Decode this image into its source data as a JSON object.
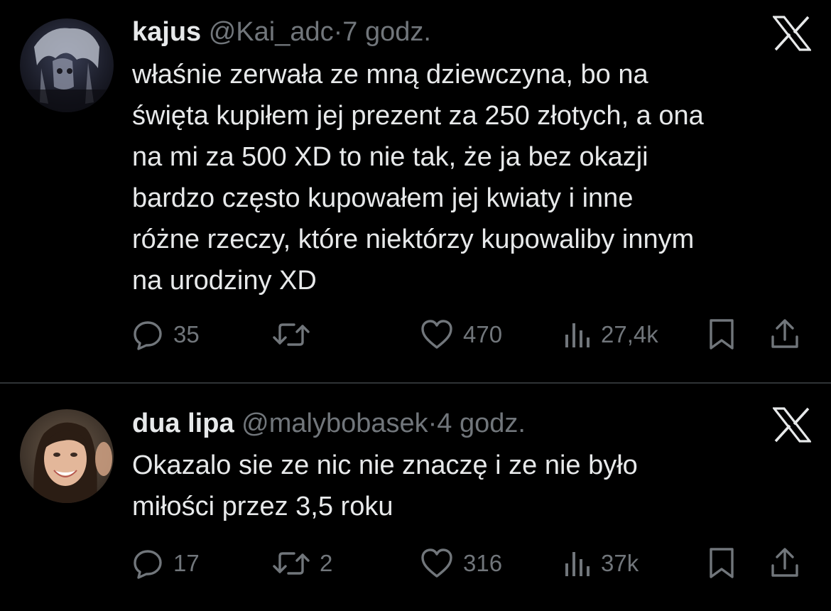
{
  "tweets": [
    {
      "display_name": "kajus",
      "handle": "@Kai_adc",
      "separator": "·",
      "time": "7 godz.",
      "text": "właśnie zerwała ze mną dziewczyna, bo na\nświęta kupiłem jej prezent za 250 złotych, a ona\nna mi za 500 XD to nie tak, że ja bez okazji\nbardzo często kupowałem jej kwiaty i inne\nróżne rzeczy, które niektórzy kupowaliby innym\nna urodziny XD",
      "replies": "35",
      "reposts": "",
      "likes": "470",
      "views": "27,4k",
      "avatar_icon": "dark-anime-avatar"
    },
    {
      "display_name": "dua lipa",
      "handle": "@malybobasek",
      "separator": "·",
      "time": "4 godz.",
      "text": "Okazalo sie ze nic nie znaczę i ze nie było\nmiłości przez 3,5 roku",
      "replies": "17",
      "reposts": "2",
      "likes": "316",
      "views": "37k",
      "avatar_icon": "smiling-woman-avatar"
    }
  ],
  "icons": {
    "brand": "x-logo-icon",
    "reply": "reply-icon",
    "repost": "repost-icon",
    "like": "heart-icon",
    "views": "views-icon",
    "bookmark": "bookmark-icon",
    "share": "share-icon"
  },
  "colors": {
    "background": "#000000",
    "text": "#e7e9ea",
    "secondary": "#71767b",
    "divider": "#2f3336"
  }
}
